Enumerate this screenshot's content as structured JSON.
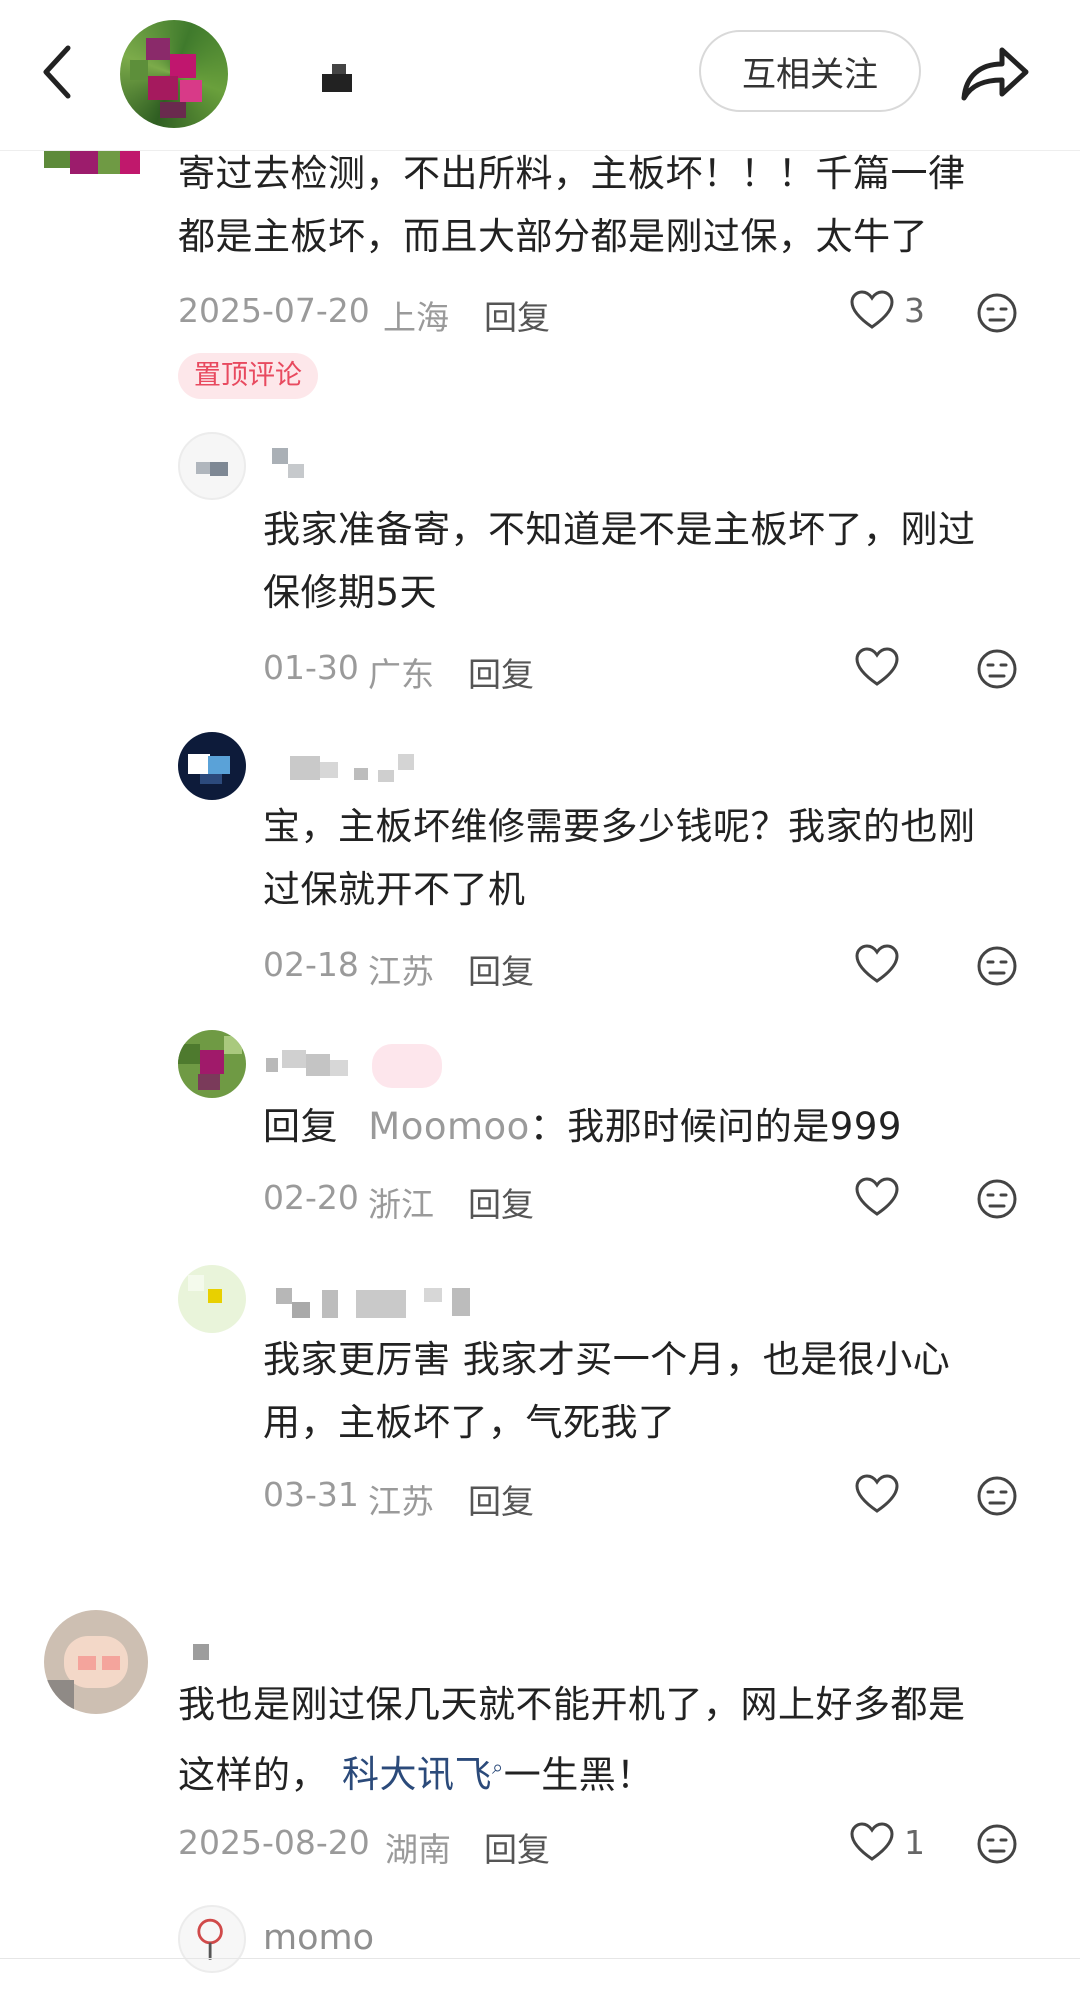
{
  "header": {
    "follow_label": "互相关注"
  },
  "comments": [
    {
      "text_lines": [
        "寄过去检测，不出所料，主板坏！！！千篇一律",
        "都是主板坏，而且大部分都是刚过保，太牛了"
      ],
      "date": "2025-07-20",
      "location": "上海",
      "reply_label": "回复",
      "likes": "3",
      "badge": "置顶评论"
    },
    {
      "text_lines": [
        "我家准备寄，不知道是不是主板坏了，刚过",
        "保修期5天"
      ],
      "date": "01-30",
      "location": "广东",
      "reply_label": "回复"
    },
    {
      "text_lines": [
        "宝，主板坏维修需要多少钱呢？我家的也刚",
        "过保就开不了机"
      ],
      "date": "02-18",
      "location": "江苏",
      "reply_label": "回复"
    },
    {
      "reply_prefix": "回复",
      "reply_to": "Moomoo",
      "text": "：我那时候问的是999",
      "date": "02-20",
      "location": "浙江",
      "reply_label": "回复"
    },
    {
      "text_lines": [
        "我家更厉害 我家才买一个月，也是很小心",
        "用，主板坏了，气死我了"
      ],
      "date": "03-31",
      "location": "江苏",
      "reply_label": "回复"
    },
    {
      "text_line1": "我也是刚过保几天就不能开机了，网上好多都是",
      "text_line2_prefix": "这样的，",
      "link_text": "科大讯飞",
      "text_line2_suffix": "一生黑！",
      "date": "2025-08-20",
      "location": "湖南",
      "reply_label": "回复",
      "likes": "1"
    }
  ],
  "next_user": {
    "name": "momo"
  },
  "colors": {
    "badge_bg": "#fde7ea",
    "badge_text": "#e84a5f",
    "link": "#2b4a7a",
    "meta": "#9a9a9a"
  }
}
